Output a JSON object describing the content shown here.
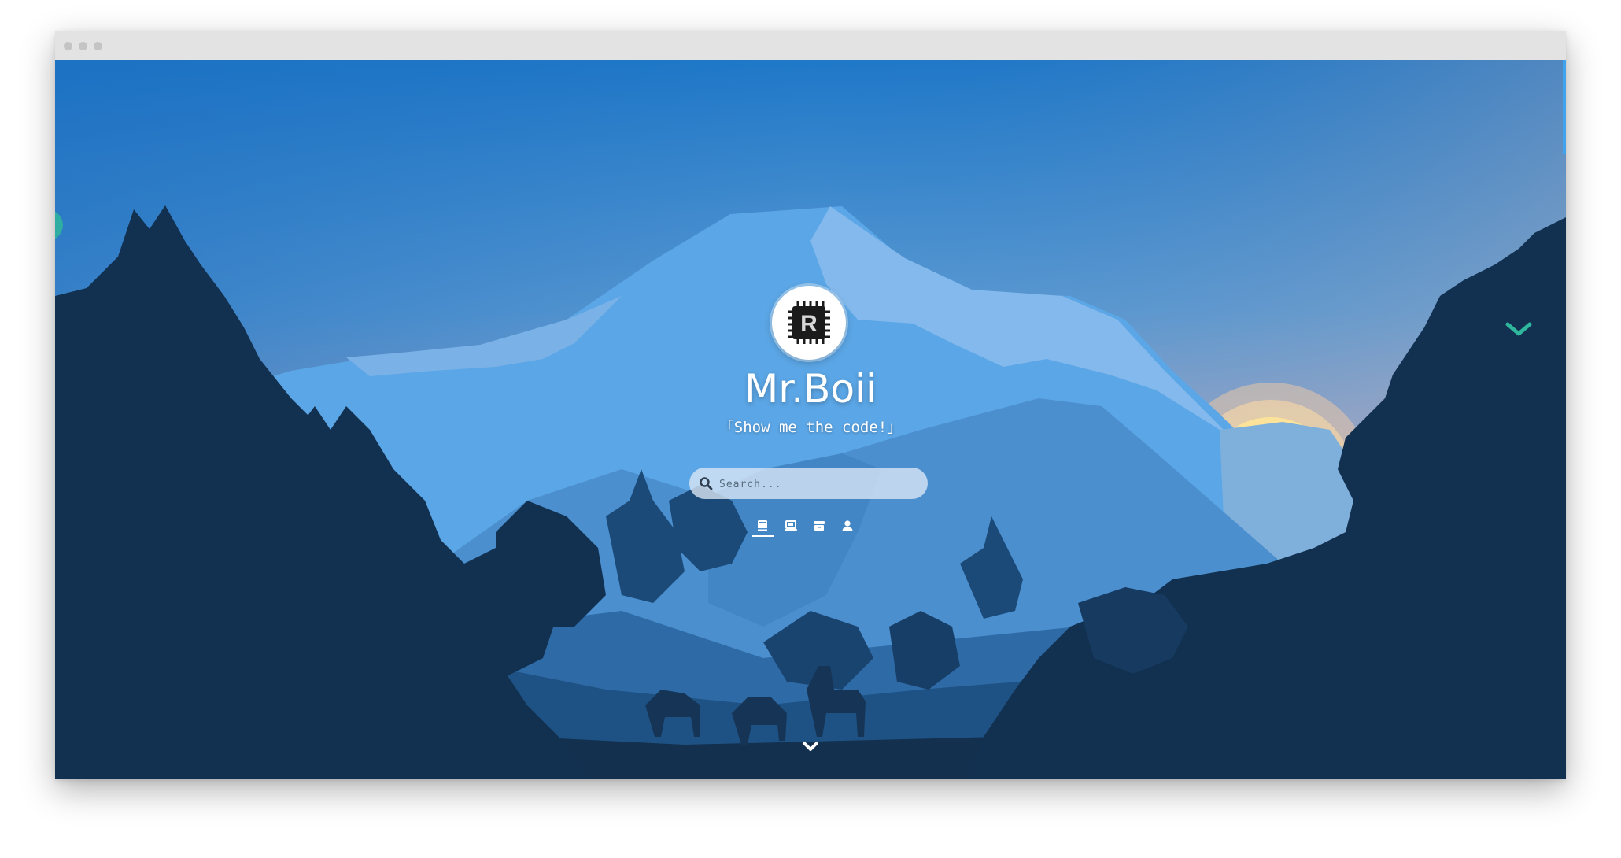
{
  "window": {
    "controls": [
      "window-dot",
      "window-dot",
      "window-dot"
    ]
  },
  "site": {
    "title": "Mr.Boii",
    "subtitle": "「Show me the code!」",
    "avatar_letter": "R"
  },
  "search": {
    "placeholder": "Search...",
    "value": ""
  },
  "nav": {
    "items": [
      {
        "icon": "book-icon",
        "active": true
      },
      {
        "icon": "laptop-icon",
        "active": false
      },
      {
        "icon": "archive-icon",
        "active": false
      },
      {
        "icon": "user-icon",
        "active": false
      }
    ]
  },
  "colors": {
    "sky_top": "#1f78c8",
    "sky_bottom": "#c6b0b6",
    "mountain_light": "#6aaee8",
    "mountain_mid": "#4f94cf",
    "forest_dark": "#0f2a44",
    "sun": "#fde39a",
    "accent_teal": "#2fb69c",
    "scrollbar": "#3fa3ee"
  }
}
